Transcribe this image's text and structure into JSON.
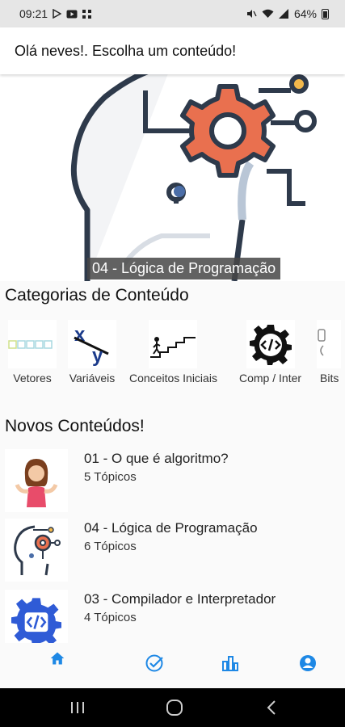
{
  "status_bar": {
    "time": "09:21",
    "battery": "64%"
  },
  "header": {
    "title": "Olá neves!. Escolha um conteúdo!"
  },
  "hero": {
    "caption": "04 - Lógica de Programação",
    "icon": "head-gear-circuit-illustration"
  },
  "categories": {
    "title": "Categorias de Conteúdo",
    "items": [
      {
        "label": "Vetores",
        "icon": "array-boxes-icon"
      },
      {
        "label": "Variáveis",
        "icon": "xy-variables-icon"
      },
      {
        "label": "Conceitos Iniciais",
        "icon": "stairs-climb-icon"
      },
      {
        "label": "Comp / Inter",
        "icon": "code-gear-icon"
      },
      {
        "label": "Bits",
        "icon": "bits-icon"
      }
    ]
  },
  "new_contents": {
    "title": "Novos Conteúdos!",
    "items": [
      {
        "title": "01 - O que é algoritmo?",
        "topics": "5 Tópicos",
        "icon": "woman-shrug-icon"
      },
      {
        "title": "04 - Lógica de Programação",
        "topics": "6 Tópicos",
        "icon": "head-gear-icon"
      },
      {
        "title": "03 - Compilador e Interpretador",
        "topics": "4 Tópicos",
        "icon": "code-gear-icon"
      }
    ]
  },
  "bottom_nav": {
    "items": [
      "home-icon",
      "check-circle-icon",
      "bar-chart-icon",
      "account-icon"
    ],
    "accent": "#1e88e5"
  },
  "colors": {
    "accent": "#1e88e5",
    "gear_orange": "#e9704f",
    "circuit_dark": "#2e3a4b"
  }
}
